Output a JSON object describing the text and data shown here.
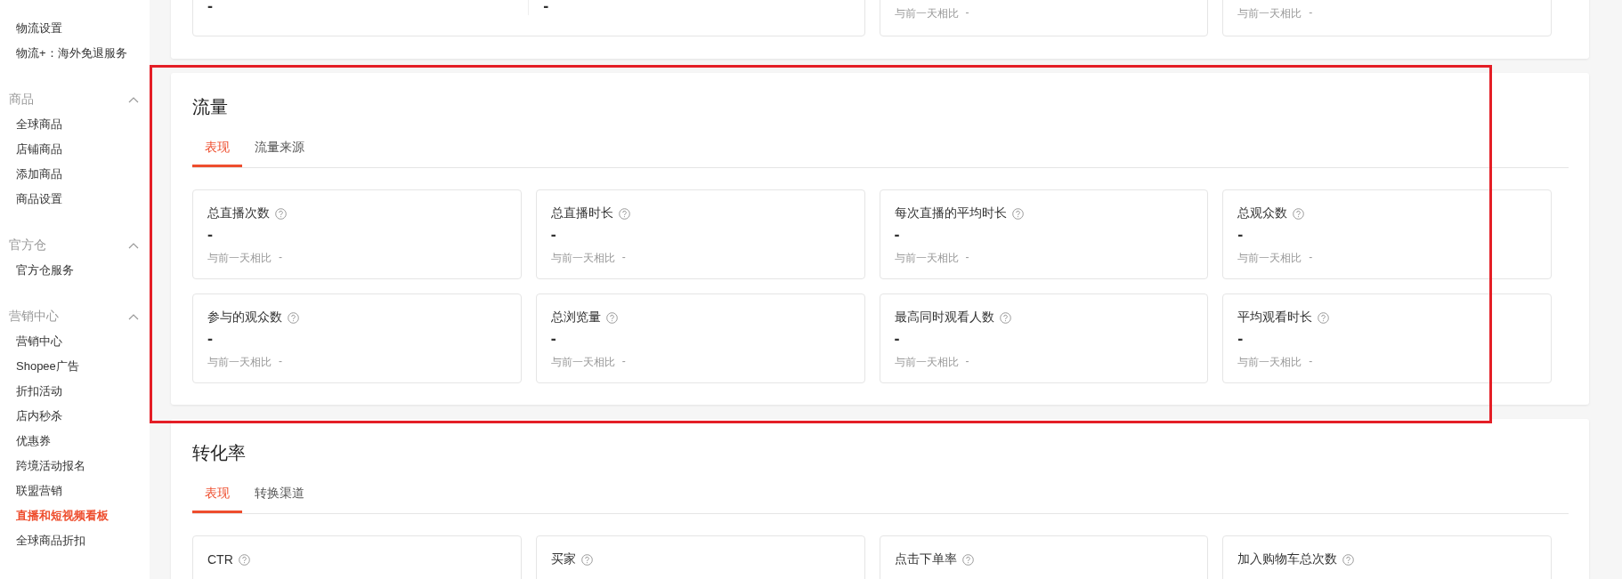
{
  "sidebar": {
    "groups": [
      {
        "items": [
          {
            "label": "物流设置",
            "selected": false
          },
          {
            "label": "物流+：海外免退服务",
            "selected": false
          }
        ]
      },
      {
        "title": "商品",
        "expanded": true,
        "items": [
          {
            "label": "全球商品",
            "selected": false
          },
          {
            "label": "店铺商品",
            "selected": false
          },
          {
            "label": "添加商品",
            "selected": false
          },
          {
            "label": "商品设置",
            "selected": false
          }
        ]
      },
      {
        "title": "官方仓",
        "expanded": true,
        "items": [
          {
            "label": "官方仓服务",
            "selected": false
          }
        ]
      },
      {
        "title": "营销中心",
        "expanded": true,
        "items": [
          {
            "label": "营销中心",
            "selected": false
          },
          {
            "label": "Shopee广告",
            "selected": false
          },
          {
            "label": "折扣活动",
            "selected": false
          },
          {
            "label": "店内秒杀",
            "selected": false
          },
          {
            "label": "优惠券",
            "selected": false
          },
          {
            "label": "跨境活动报名",
            "selected": false
          },
          {
            "label": "联盟营销",
            "selected": false
          },
          {
            "label": "直播和短视频看板",
            "selected": true
          },
          {
            "label": "全球商品折扣",
            "selected": false
          }
        ]
      }
    ]
  },
  "top_section": {
    "wide_card": {
      "values": [
        "-",
        "-"
      ]
    },
    "cards": [
      {
        "comparison_label": "与前一天相比",
        "comparison_value": "-"
      },
      {
        "comparison_label": "与前一天相比",
        "comparison_value": "-"
      }
    ]
  },
  "sections": [
    {
      "title": "流量",
      "tabs": [
        {
          "label": "表现",
          "selected": true
        },
        {
          "label": "流量来源",
          "selected": false
        }
      ],
      "metrics": [
        {
          "label": "总直播次数",
          "value": "-",
          "comparison_label": "与前一天相比",
          "comparison_value": "-"
        },
        {
          "label": "总直播时长",
          "value": "-",
          "comparison_label": "与前一天相比",
          "comparison_value": "-"
        },
        {
          "label": "每次直播的平均时长",
          "value": "-",
          "comparison_label": "与前一天相比",
          "comparison_value": "-"
        },
        {
          "label": "总观众数",
          "value": "-",
          "comparison_label": "与前一天相比",
          "comparison_value": "-"
        },
        {
          "label": "参与的观众数",
          "value": "-",
          "comparison_label": "与前一天相比",
          "comparison_value": "-"
        },
        {
          "label": "总浏览量",
          "value": "-",
          "comparison_label": "与前一天相比",
          "comparison_value": "-"
        },
        {
          "label": "最高同时观看人数",
          "value": "-",
          "comparison_label": "与前一天相比",
          "comparison_value": "-"
        },
        {
          "label": "平均观看时长",
          "value": "-",
          "comparison_label": "与前一天相比",
          "comparison_value": "-"
        }
      ]
    },
    {
      "title": "转化率",
      "tabs": [
        {
          "label": "表现",
          "selected": true
        },
        {
          "label": "转换渠道",
          "selected": false
        }
      ],
      "metrics": [
        {
          "label": "CTR"
        },
        {
          "label": "买家"
        },
        {
          "label": "点击下单率"
        },
        {
          "label": "加入购物车总次数"
        }
      ]
    }
  ],
  "annotations": [
    {
      "kind": "frame"
    }
  ]
}
